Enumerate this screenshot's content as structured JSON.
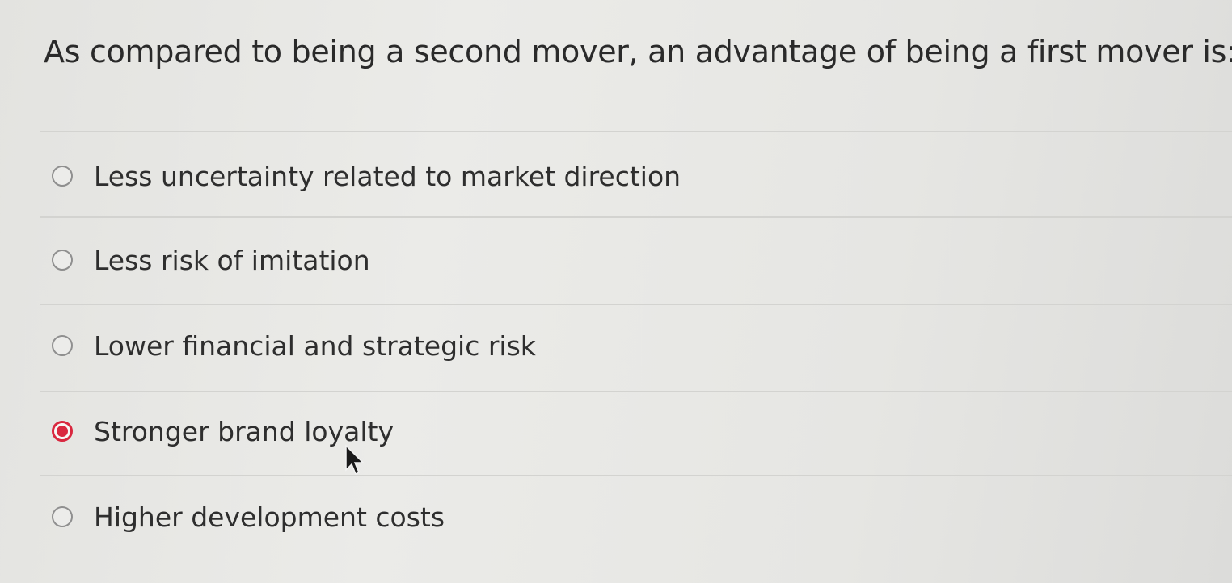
{
  "question": {
    "text": "As compared to being a second mover, an advantage of being a first mover is:"
  },
  "options": [
    {
      "label": "Less uncertainty related to market direction",
      "selected": false
    },
    {
      "label": "Less risk of imitation",
      "selected": false
    },
    {
      "label": "Lower financial and strategic risk",
      "selected": false
    },
    {
      "label": "Stronger brand loyalty",
      "selected": true
    },
    {
      "label": "Higher development costs",
      "selected": false
    }
  ],
  "colors": {
    "selected_accent": "#d9283f",
    "text": "#2e2e2e",
    "background": "#e8e8e5"
  },
  "icons": {
    "cursor": "mouse-pointer-icon"
  }
}
